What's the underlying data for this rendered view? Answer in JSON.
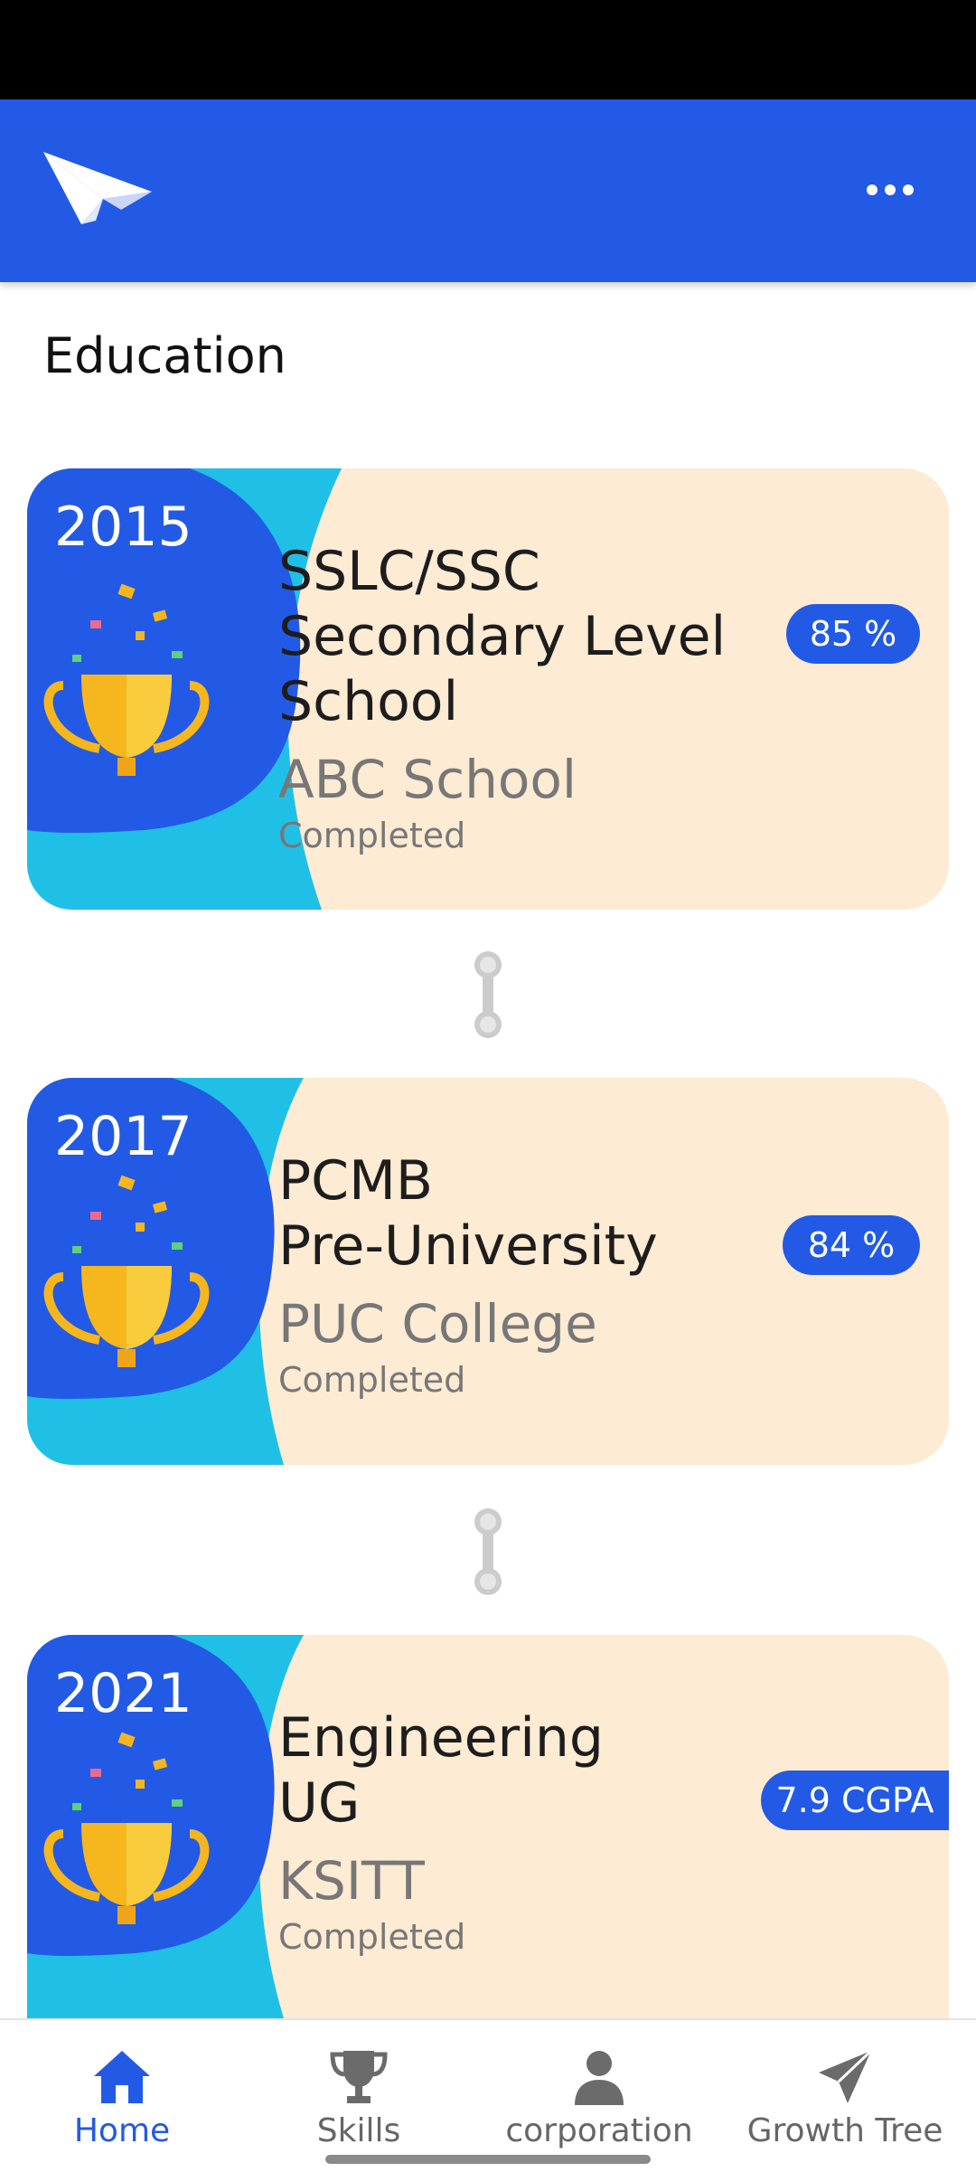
{
  "colors": {
    "primary": "#235ae5",
    "accent_light_blue": "#20c0e6",
    "card_background": "#fdebd3",
    "trophy_gold": "#f6b61d",
    "connector_gray": "#cccccc"
  },
  "header": {
    "logo_icon": "paper-plane-logo",
    "menu_icon": "more-horizontal-icon"
  },
  "page": {
    "title": "Education"
  },
  "education": [
    {
      "year": "2015",
      "title": "SSLC/SSC\nSecondary Level\nSchool",
      "institution": "ABC School",
      "status": "Completed",
      "grade": "85 %"
    },
    {
      "year": "2017",
      "title": "PCMB\nPre-University",
      "institution": "PUC College",
      "status": "Completed",
      "grade": "84 %"
    },
    {
      "year": "2021",
      "title": "Engineering\nUG",
      "institution": "KSITT",
      "status": "Completed",
      "grade": "7.9 CGPA"
    }
  ],
  "bottom_nav": {
    "items": [
      {
        "label": "Home",
        "icon": "home-icon",
        "active": true
      },
      {
        "label": "Skills",
        "icon": "trophy-icon",
        "active": false
      },
      {
        "label": "corporation",
        "icon": "person-icon",
        "active": false
      },
      {
        "label": "Growth Tree",
        "icon": "send-icon",
        "active": false
      }
    ]
  }
}
